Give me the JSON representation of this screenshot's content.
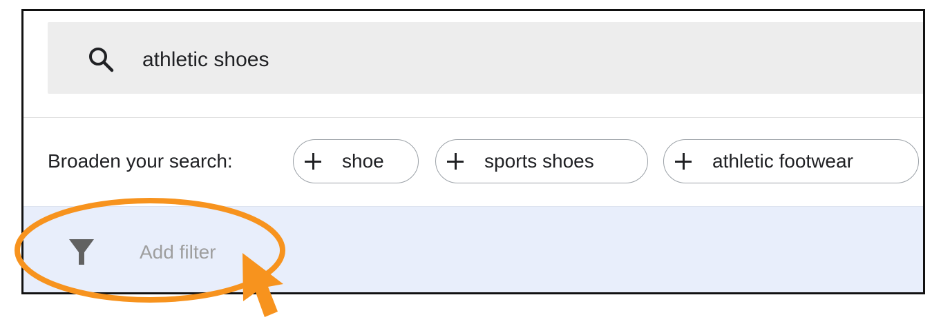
{
  "search": {
    "query": "athletic shoes",
    "icon": "search-icon"
  },
  "broaden": {
    "label": "Broaden your search:",
    "chips": [
      {
        "label": "shoe",
        "icon": "plus-icon"
      },
      {
        "label": "sports shoes",
        "icon": "plus-icon"
      },
      {
        "label": "athletic footwear",
        "icon": "plus-icon"
      }
    ]
  },
  "filter": {
    "placeholder": "Add filter",
    "icon": "filter-icon"
  },
  "annotation": {
    "highlight_color": "#f7931e",
    "shapes": [
      "ellipse-highlight",
      "arrow-pointer"
    ]
  },
  "colors": {
    "filter_row_bg": "#e8eefb",
    "search_bar_bg": "#ededed",
    "frame_border": "#111111"
  }
}
